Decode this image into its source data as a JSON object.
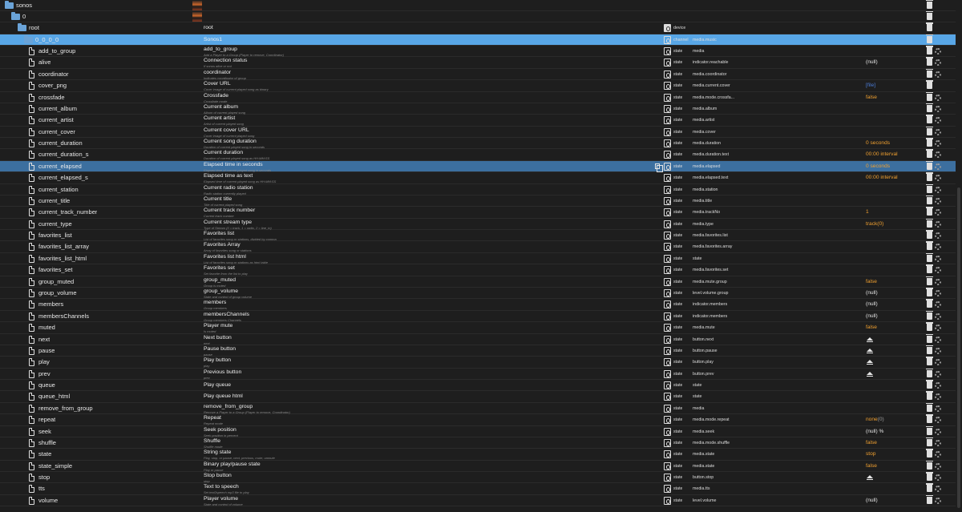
{
  "tree": {
    "rows": [
      {
        "kind": "folder",
        "indent": 0,
        "id": "sonos",
        "name": "",
        "thumb": true
      },
      {
        "kind": "folder",
        "indent": 1,
        "id": "0",
        "name": "",
        "thumb": true
      },
      {
        "kind": "folder",
        "indent": 2,
        "id": "root",
        "name": "root",
        "type_icon": "device",
        "type": "device"
      },
      {
        "kind": "folder",
        "indent": 3,
        "id": "0_0_0_0",
        "name": "Sonos1",
        "type_icon": "channel",
        "type": "channel",
        "role": "media.music",
        "highlight": true
      },
      {
        "kind": "state",
        "id": "add_to_group",
        "name": "add_to_group",
        "desc": "Add a Player to a Group (Player to remove, Coordinator)",
        "type": "state",
        "role": "media"
      },
      {
        "kind": "state",
        "id": "alive",
        "name": "Connection status",
        "desc": "If sonos alive or not",
        "type": "state",
        "role": "indicator.reachable",
        "value": "(null)",
        "vcolor": "white"
      },
      {
        "kind": "state",
        "id": "coordinator",
        "name": "coordinator",
        "desc": "Indicates coordinator of group",
        "type": "state",
        "role": "media.coordinator"
      },
      {
        "kind": "state",
        "id": "cover_png",
        "name": "Cover URL",
        "desc": "Cover image of current played song as binary",
        "type": "state",
        "role": "media.current.cover",
        "value": "[file]",
        "vcolor": "blue",
        "nogear": true
      },
      {
        "kind": "state",
        "id": "crossfade",
        "name": "Crossfade",
        "desc": "Crossfade mode",
        "type": "state",
        "role": "media.mode.crossfa...",
        "value": "false",
        "vcolor": "orange"
      },
      {
        "kind": "state",
        "id": "current_album",
        "name": "Current album",
        "desc": "Album of current played song",
        "type": "state",
        "role": "media.album"
      },
      {
        "kind": "state",
        "id": "current_artist",
        "name": "Current artist",
        "desc": "Artist of current played song",
        "type": "state",
        "role": "media.artist"
      },
      {
        "kind": "state",
        "id": "current_cover",
        "name": "Current cover URL",
        "desc": "Cover image of current played song",
        "type": "state",
        "role": "media.cover"
      },
      {
        "kind": "state",
        "id": "current_duration",
        "name": "Current song duration",
        "desc": "Duration of current played song in seconds",
        "type": "state",
        "role": "media.duration",
        "value": "0 seconds",
        "vcolor": "orange"
      },
      {
        "kind": "state",
        "id": "current_duration_s",
        "name": "Current duration",
        "desc": "Duration of current played song as HH:MM:SS",
        "type": "state",
        "role": "media.duration.text",
        "value": "00:00 interval",
        "vcolor": "orange"
      },
      {
        "kind": "state",
        "id": "current_elapsed",
        "name": "Elapsed time in seconds",
        "desc": "Elapsed time of current played song in seconds",
        "type": "state",
        "role": "media.elapsed",
        "value": "0 seconds",
        "vcolor": "orange",
        "selected": true
      },
      {
        "kind": "state",
        "id": "current_elapsed_s",
        "name": "Elapsed time as text",
        "desc": "Elapsed time of current played song as HH:MM:SS",
        "type": "state",
        "role": "media.elapsed.text",
        "value": "00:00 interval",
        "vcolor": "orange"
      },
      {
        "kind": "state",
        "id": "current_station",
        "name": "Current radio station",
        "desc": "Radio station currently played",
        "type": "state",
        "role": "media.station"
      },
      {
        "kind": "state",
        "id": "current_title",
        "name": "Current title",
        "desc": "Title of current played song",
        "type": "state",
        "role": "media.title"
      },
      {
        "kind": "state",
        "id": "current_track_number",
        "name": "Current track number",
        "desc": "Current track number",
        "type": "state",
        "role": "media.trackNo",
        "value": "1",
        "vcolor": "orange"
      },
      {
        "kind": "state",
        "id": "current_type",
        "name": "Current stream type",
        "desc": "Type of Stream (0 = track, 1 = radio, 2 = line_in)",
        "type": "state",
        "role": "media.type",
        "value": "track(0)",
        "vcolor": "orange"
      },
      {
        "kind": "state",
        "id": "favorites_list",
        "name": "Favorites list",
        "desc": "List of favorites song or stations, divided by comma",
        "type": "state",
        "role": "media.favorites.list"
      },
      {
        "kind": "state",
        "id": "favorites_list_array",
        "name": "Favorites Array",
        "desc": "Array of favorites song or stations",
        "type": "state",
        "role": "media.favorites.array"
      },
      {
        "kind": "state",
        "id": "favorites_list_html",
        "name": "Favorites list html",
        "desc": "List of favorites song or stations as html table",
        "type": "state",
        "role": "state"
      },
      {
        "kind": "state",
        "id": "favorites_set",
        "name": "Favorites set",
        "desc": "Set favorite from the list to play",
        "type": "state",
        "role": "media.favorites.set"
      },
      {
        "kind": "state",
        "id": "group_muted",
        "name": "group_muted",
        "desc": "Group is muted",
        "type": "state",
        "role": "media.mute.group",
        "value": "false",
        "vcolor": "orange"
      },
      {
        "kind": "state",
        "id": "group_volume",
        "name": "group_volume",
        "desc": "State and control of group volume",
        "type": "state",
        "role": "level.volume.group",
        "value": "(null)",
        "vcolor": "white"
      },
      {
        "kind": "state",
        "id": "members",
        "name": "members",
        "desc": "Group members",
        "type": "state",
        "role": "indicator.members",
        "value": "(null)",
        "vcolor": "white"
      },
      {
        "kind": "state",
        "id": "membersChannels",
        "name": "membersChannels",
        "desc": "Group members Channels",
        "type": "state",
        "role": "indicator.members",
        "value": "(null)",
        "vcolor": "white"
      },
      {
        "kind": "state",
        "id": "muted",
        "name": "Player mute",
        "desc": "Is muted",
        "type": "state",
        "role": "media.mute",
        "value": "false",
        "vcolor": "orange"
      },
      {
        "kind": "state",
        "id": "next",
        "name": "Next button",
        "desc": "next",
        "type": "state",
        "role": "button.next",
        "button": true
      },
      {
        "kind": "state",
        "id": "pause",
        "name": "Pause button",
        "desc": "pause",
        "type": "state",
        "role": "button.pause",
        "button": true
      },
      {
        "kind": "state",
        "id": "play",
        "name": "Play button",
        "desc": "play",
        "type": "state",
        "role": "button.play",
        "button": true
      },
      {
        "kind": "state",
        "id": "prev",
        "name": "Previous button",
        "desc": "prev",
        "type": "state",
        "role": "button.prev",
        "button": true
      },
      {
        "kind": "state",
        "id": "queue",
        "name": "Play queue",
        "desc": "",
        "type": "state",
        "role": "state"
      },
      {
        "kind": "state",
        "id": "queue_html",
        "name": "Play queue html",
        "desc": "",
        "type": "state",
        "role": "state"
      },
      {
        "kind": "state",
        "id": "remove_from_group",
        "name": "remove_from_group",
        "desc": "Remove a Player to a Group (Player to remove, Coordinator)",
        "type": "state",
        "role": "media"
      },
      {
        "kind": "state",
        "id": "repeat",
        "name": "Repeat",
        "desc": "Repeat mode",
        "type": "state",
        "role": "media.mode.repeat",
        "value": "none",
        "value_extra": "(0)",
        "vcolor": "orange"
      },
      {
        "kind": "state",
        "id": "seek",
        "name": "Seek position",
        "desc": "Seek position in percent",
        "type": "state",
        "role": "media.seek",
        "value": "(null) %",
        "vcolor": "white"
      },
      {
        "kind": "state",
        "id": "shuffle",
        "name": "Shuffle",
        "desc": "Shuffle mode",
        "type": "state",
        "role": "media.mode.shuffle",
        "value": "false",
        "vcolor": "orange"
      },
      {
        "kind": "state",
        "id": "state",
        "name": "String state",
        "desc": "Play, stop, or pause, next, previous, mute, unmute",
        "type": "state",
        "role": "media.state",
        "value": "stop",
        "vcolor": "orange"
      },
      {
        "kind": "state",
        "id": "state_simple",
        "name": "Binary play/pause state",
        "desc": "Play or pause",
        "type": "state",
        "role": "media.state",
        "value": "false",
        "vcolor": "orange"
      },
      {
        "kind": "state",
        "id": "stop",
        "name": "Stop button",
        "desc": "stop",
        "type": "state",
        "role": "button.stop",
        "button": true
      },
      {
        "kind": "state",
        "id": "tts",
        "name": "Text to speech",
        "desc": "Set text2speech mp3 file to play",
        "type": "state",
        "role": "media.tts"
      },
      {
        "kind": "state",
        "id": "volume",
        "name": "Player volume",
        "desc": "State and control of volume",
        "type": "state",
        "role": "level.volume",
        "value": "(null)",
        "vcolor": "white"
      }
    ]
  }
}
